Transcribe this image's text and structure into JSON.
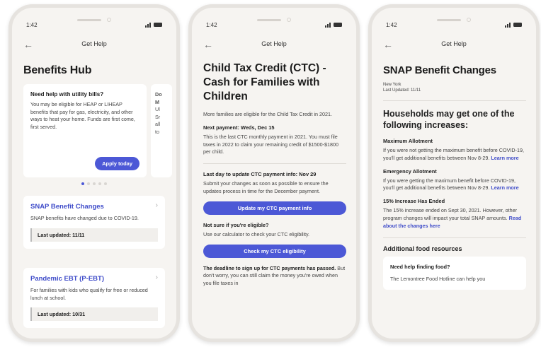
{
  "status": {
    "time": "1:42"
  },
  "nav": {
    "title": "Get Help"
  },
  "phone1": {
    "heading": "Benefits Hub",
    "promo": {
      "title": "Need help with utility bills?",
      "body": "You may be eligible for HEAP or LIHEAP benefits that pay for gas, electricity, and other ways to heat your home. Funds are first come, first served.",
      "button": "Apply today"
    },
    "peek": {
      "line1": "Do",
      "line2": "M",
      "line3": "Ul",
      "line4": "Sr",
      "line5": "all",
      "line6": "to"
    },
    "cards": [
      {
        "title": "SNAP Benefit Changes",
        "body": "SNAP benefits have changed due to COVID-19.",
        "updated": "Last updated: 11/11"
      },
      {
        "title": "Pandemic EBT (P-EBT)",
        "body": "For families with kids who qualify for free or reduced lunch at school.",
        "updated": "Last updated: 10/31"
      }
    ]
  },
  "phone2": {
    "heading": "Child Tax Credit (CTC) - Cash for Families with Children",
    "intro": "More families are eligible for the Child Tax Credit in 2021.",
    "next_payment_label": "Next payment: Weds, Dec 15",
    "next_payment_body": "This is the last CTC monthly payment in 2021. You must file taxes in 2022 to claim your remaining credit of $1500-$1800 per child.",
    "update_label": "Last day to update CTC payment info: Nov 29",
    "update_body": "Submit your changes as soon as possible to ensure the updates process in time for the December payment.",
    "update_button": "Update my CTC payment info",
    "eligible_label": "Not sure if you're eligible?",
    "eligible_body": "Use our calculator to check your CTC eligibility.",
    "eligible_button": "Check my CTC eligibility",
    "deadline_bold": "The deadline to sign up for CTC payments has passed.",
    "deadline_rest": " But don't worry, you can still claim the money you're owed when you file taxes in"
  },
  "phone3": {
    "heading": "SNAP Benefit Changes",
    "location": "New York",
    "last_updated": "Last Updated: 11/11",
    "subheading": "Households may get one of the following increases:",
    "sections": [
      {
        "title": "Maximum Allotment",
        "body": "If you were not getting the maximum benefit before COVID-19, you'll get additional benefits between Nov 8-29.",
        "link": "Learn more"
      },
      {
        "title": "Emergency Allotment",
        "body": "If you were getting the maximum benefit before COVID-19, you'll get additional benefits between Nov 8-29.",
        "link": "Learn more"
      },
      {
        "title": "15% Increase Has Ended",
        "body": "The 15% increase ended on Sept 30, 2021. However, other program changes will impact your total SNAP amounts.",
        "link": "Read about the changes here"
      }
    ],
    "resources_heading": "Additional food resources",
    "help_title": "Need help finding food?",
    "help_body": "The Lemontree Food Hotline can help you"
  },
  "colors": {
    "accent": "#4c58d6",
    "link": "#3f4cc9",
    "background": "#f6f4f1"
  }
}
